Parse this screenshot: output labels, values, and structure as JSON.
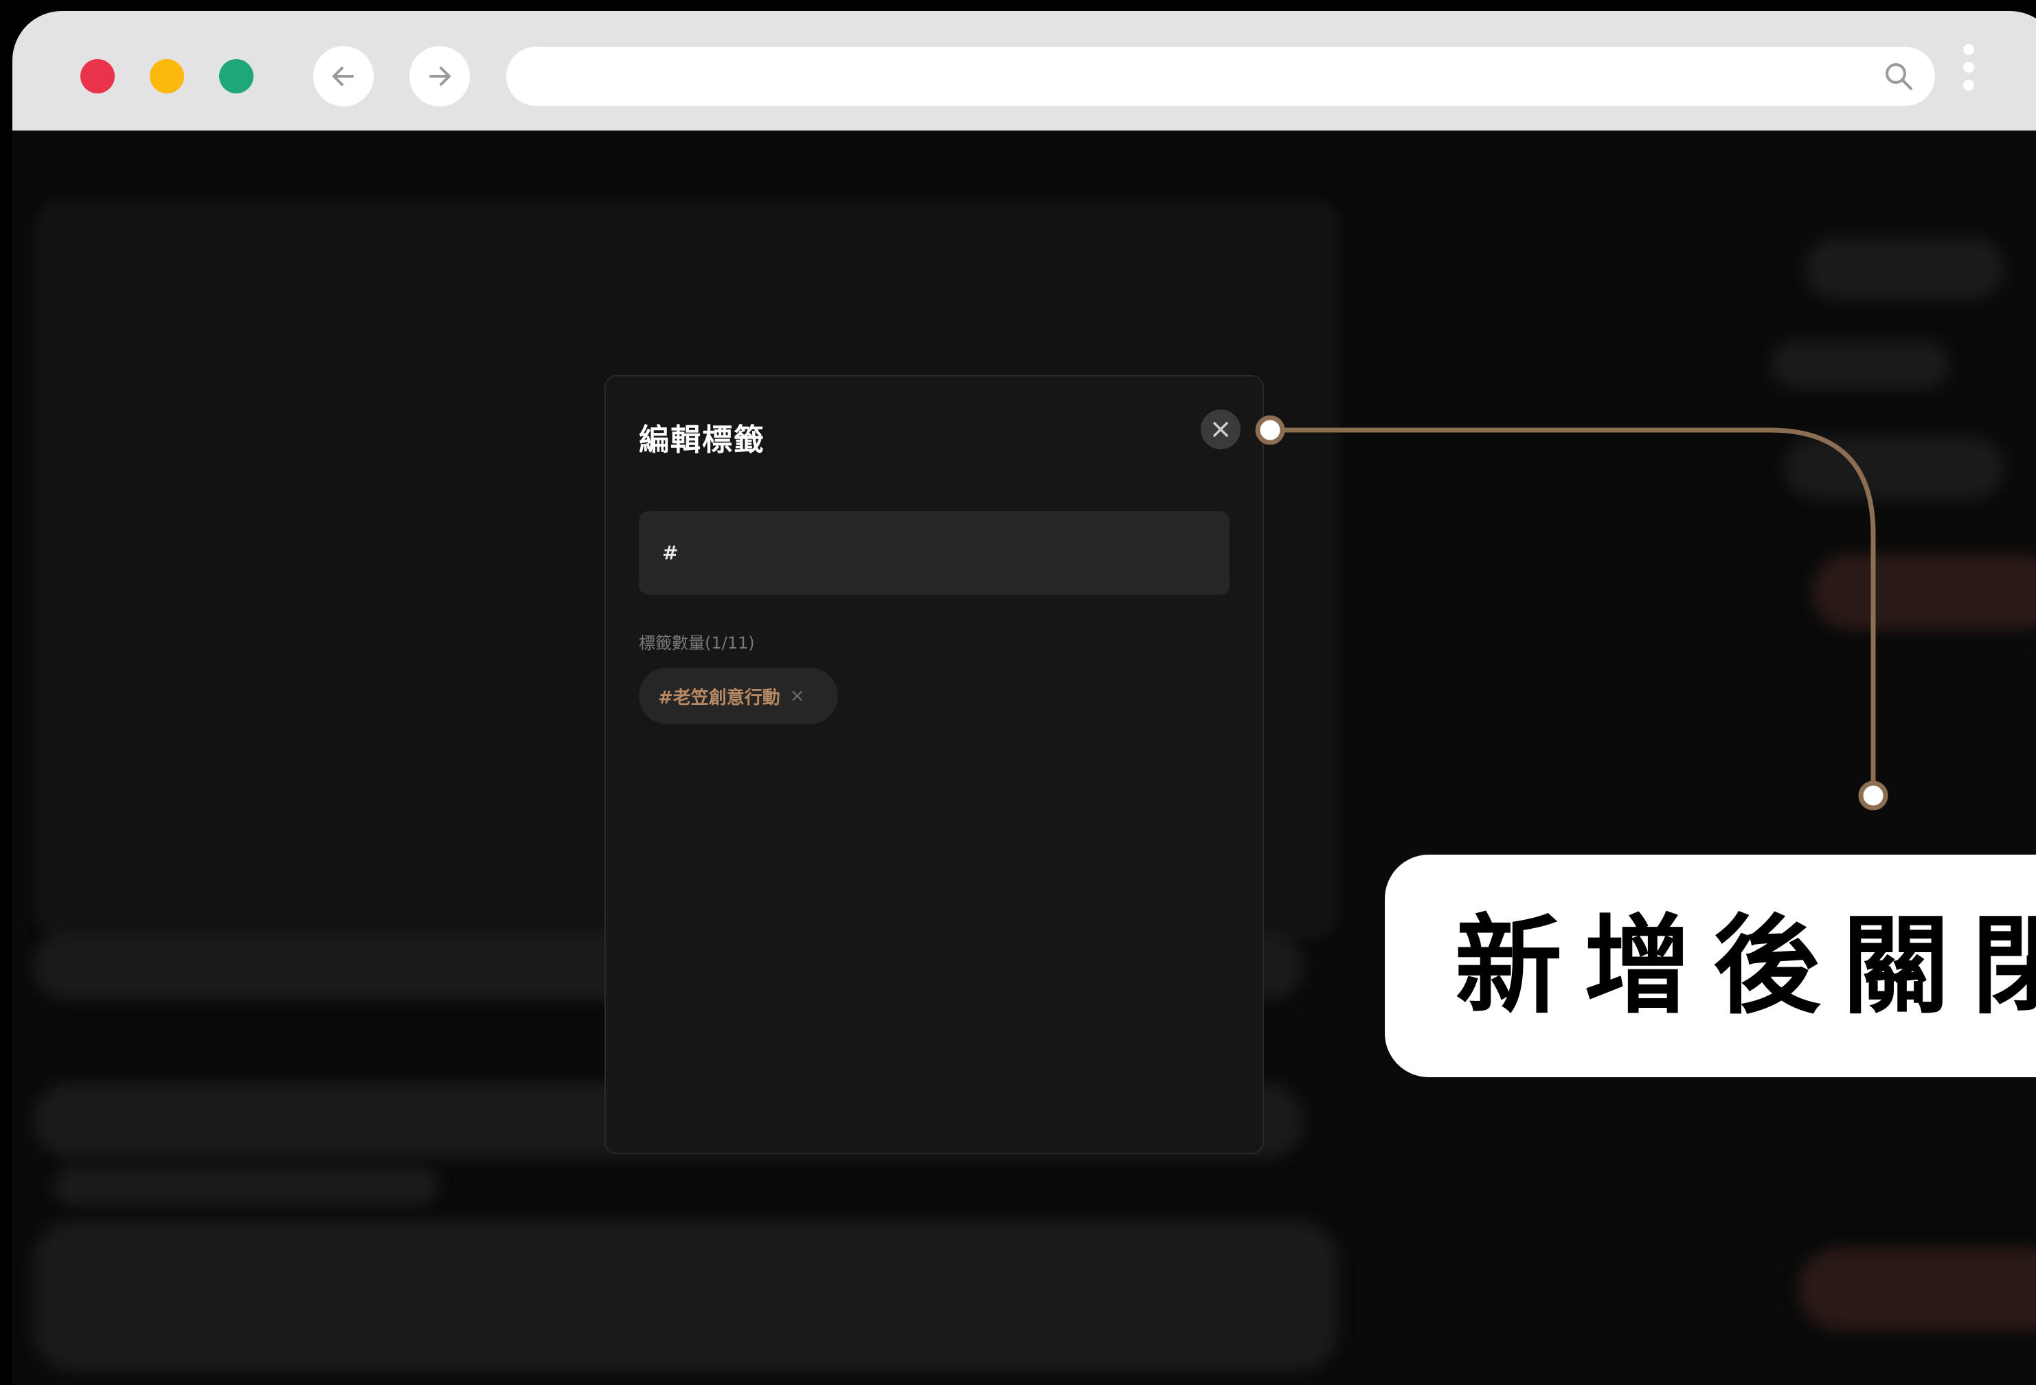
{
  "browser": {
    "back_icon": "arrow-left-icon",
    "forward_icon": "arrow-right-icon",
    "search_icon": "search-icon",
    "menu_icon": "more-vertical-icon",
    "url": ""
  },
  "modal": {
    "title": "編輯標籤",
    "close_icon": "close-icon",
    "input_value": "#",
    "count_label": "標籤數量(1/11)",
    "tags": [
      {
        "label": "#老笠創意行動",
        "remove": "×"
      }
    ]
  },
  "annotation": {
    "callout_text": "新增後關閉",
    "line_color": "#8c6e52"
  }
}
